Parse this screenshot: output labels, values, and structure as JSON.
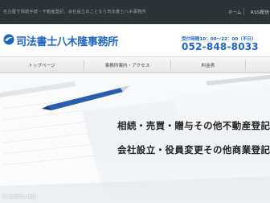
{
  "topbar": {
    "tagline": "名古屋で相続手続・不動産登記、会社設立のことなら司法書士八木事務所",
    "home_label": "ホーム",
    "rss_label": "RSS配信"
  },
  "header": {
    "site_title": "司法書士八木隆事務所",
    "hours": "受付時間10：00～22：00（平日）",
    "phone": "052-848-8033"
  },
  "nav": {
    "items": [
      "トップページ",
      "事務所案内・アクセス",
      "料金表"
    ]
  },
  "hero": {
    "line1": "相続・売買・贈与その他不動産登記",
    "line2": "会社設立・役員変更その他商業登記"
  },
  "watermark": "© sitelike.org",
  "colors": {
    "brand_blue": "#1e66c4",
    "topbar_bg": "#2d3438"
  }
}
